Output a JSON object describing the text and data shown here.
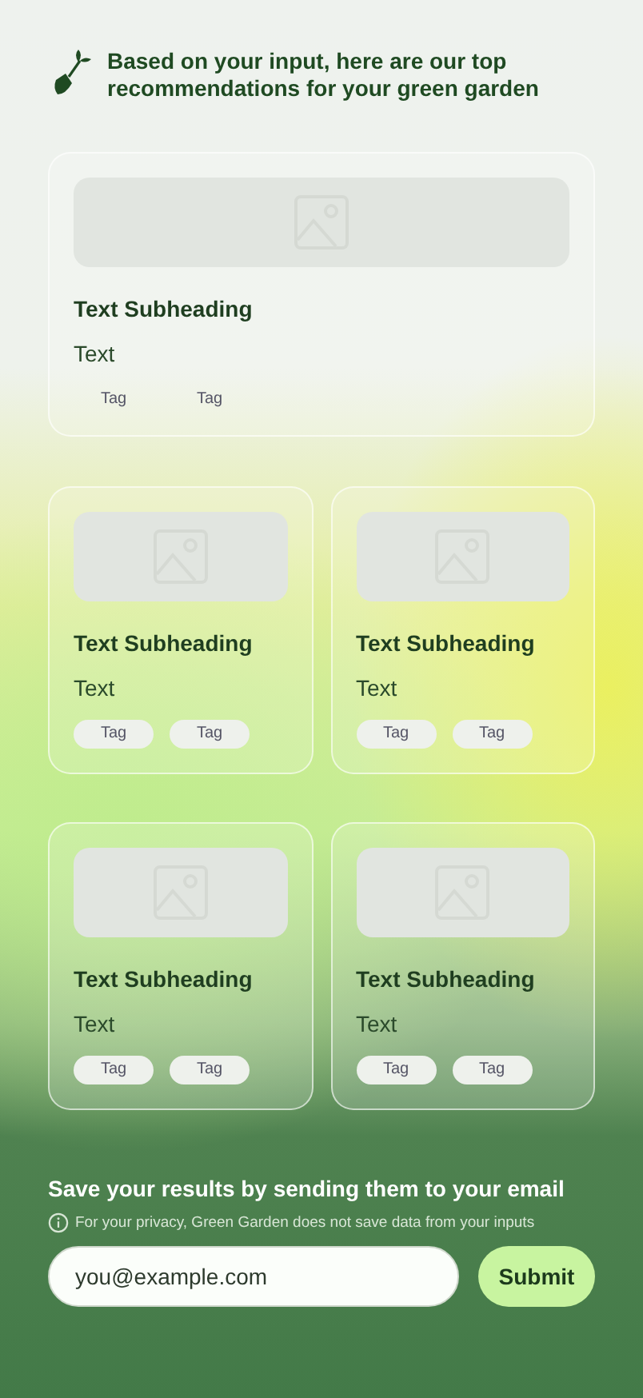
{
  "header": {
    "title": "Based on your input, here are our top recommendations for your green garden"
  },
  "cards": [
    {
      "kind": "wide",
      "subheading": "Text Subheading",
      "text": "Text",
      "tags": [
        "Tag",
        "Tag"
      ]
    },
    {
      "kind": "compact",
      "subheading": "Text Subheading",
      "text": "Text",
      "tags": [
        "Tag",
        "Tag"
      ]
    },
    {
      "kind": "compact",
      "subheading": "Text Subheading",
      "text": "Text",
      "tags": [
        "Tag",
        "Tag"
      ]
    },
    {
      "kind": "compact",
      "subheading": "Text Subheading",
      "text": "Text",
      "tags": [
        "Tag",
        "Tag"
      ]
    },
    {
      "kind": "compact",
      "subheading": "Text Subheading",
      "text": "Text",
      "tags": [
        "Tag",
        "Tag"
      ]
    }
  ],
  "email": {
    "heading": "Save your results by sending them to your email",
    "note": "For your privacy, Green Garden does not save data from your inputs",
    "placeholder": "you@example.com",
    "button": "Submit"
  }
}
